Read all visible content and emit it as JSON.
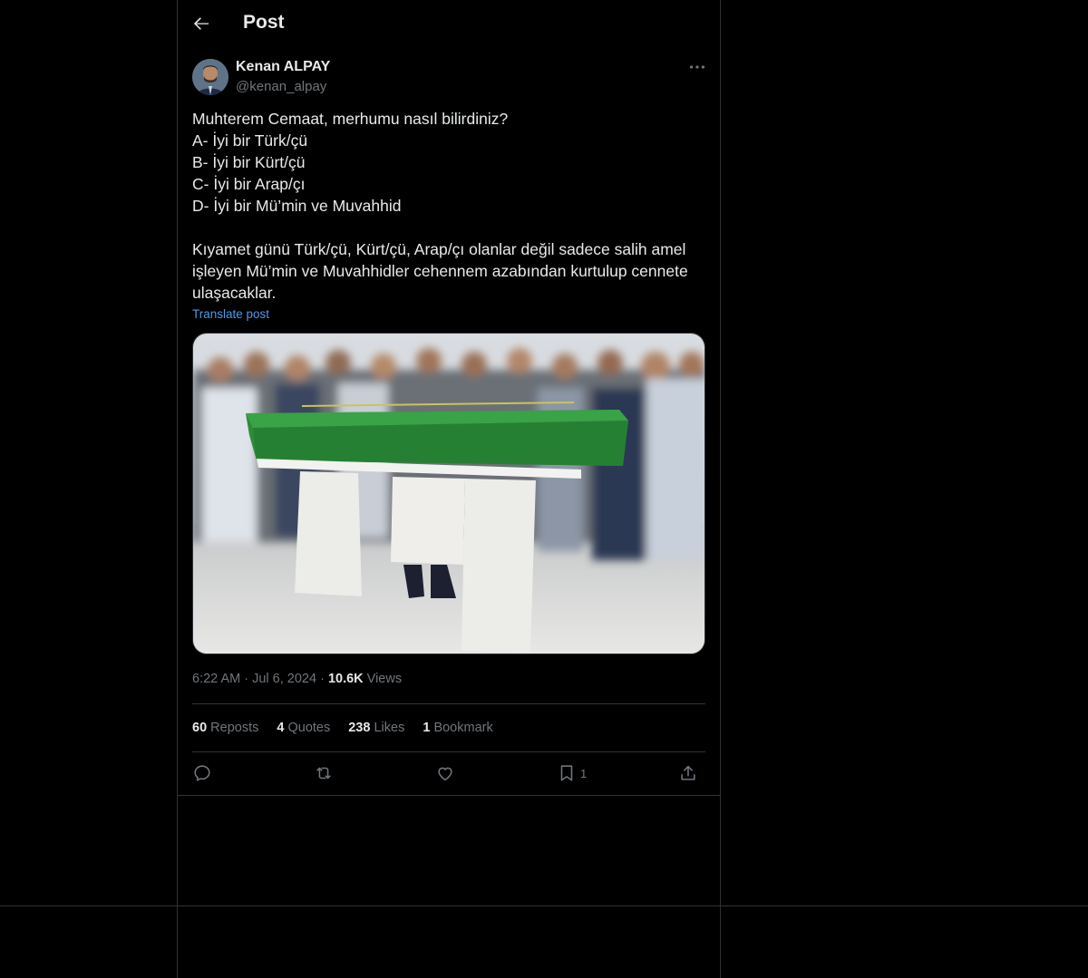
{
  "header": {
    "title": "Post"
  },
  "author": {
    "name": "Kenan ALPAY",
    "handle": "@kenan_alpay"
  },
  "post": {
    "text": "Muhterem Cemaat, merhumu nasıl bilirdiniz?\nA- İyi bir Türk/çü\nB- İyi bir Kürt/çü\nC- İyi bir Arap/çı\nD- İyi bir Mü’min ve Muvahhid\n\nKıyamet günü Türk/çü, Kürt/çü, Arap/çı olanlar değil sadece salih amel işleyen Mü’min ve Muvahhidler cehennem azabından kurtulup cennete ulaşacaklar.",
    "translate_label": "Translate post"
  },
  "meta": {
    "time": "6:22 AM",
    "date": "Jul 6, 2024",
    "views_count": "10.6K",
    "views_label": "Views"
  },
  "stats": {
    "reposts": {
      "count": "60",
      "label": "Reposts"
    },
    "quotes": {
      "count": "4",
      "label": "Quotes"
    },
    "likes": {
      "count": "238",
      "label": "Likes"
    },
    "bookmarks": {
      "count": "1",
      "label": "Bookmark"
    }
  },
  "actions": {
    "bookmark_count": "1"
  },
  "icons": [
    "back-arrow-icon",
    "more-icon",
    "reply-icon",
    "repost-icon",
    "like-icon",
    "bookmark-icon",
    "share-icon"
  ],
  "colors": {
    "background": "#000000",
    "text": "#e7e9ea",
    "muted": "#71767b",
    "link": "#4c9ae8",
    "border": "#2f3336"
  }
}
